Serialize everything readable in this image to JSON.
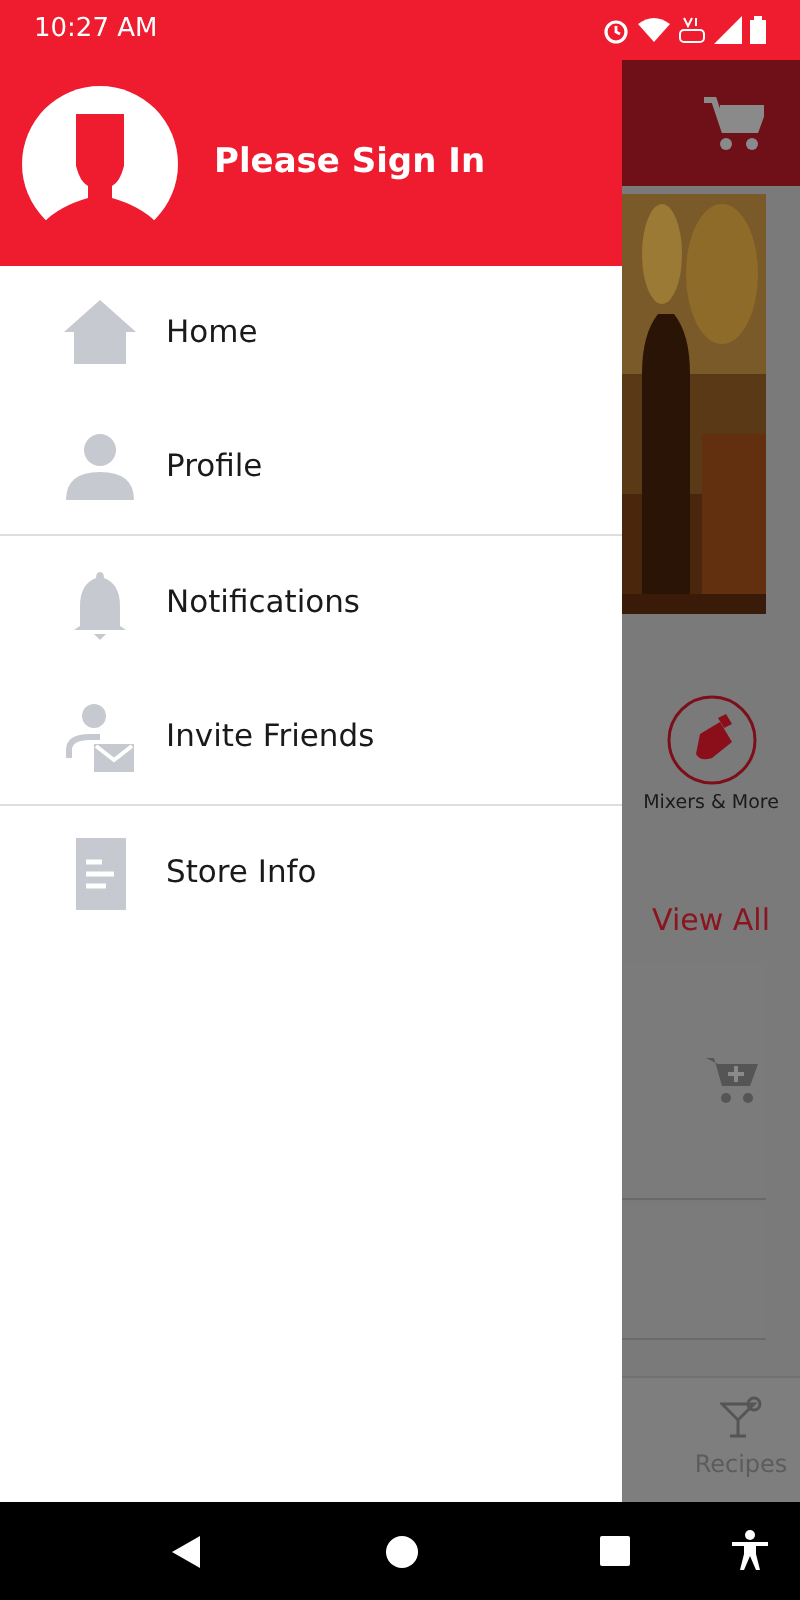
{
  "status_bar": {
    "time": "10:27 AM"
  },
  "drawer": {
    "header": {
      "title": "Please Sign In"
    },
    "sections": [
      {
        "items": [
          {
            "label": "Home"
          },
          {
            "label": "Profile"
          }
        ]
      },
      {
        "items": [
          {
            "label": "Notifications"
          },
          {
            "label": "Invite Friends"
          }
        ]
      },
      {
        "items": [
          {
            "label": "Store Info"
          }
        ]
      }
    ]
  },
  "background": {
    "category": {
      "label": "Mixers & More"
    },
    "link": "View All",
    "bottom_nav": {
      "label": "Recipes"
    }
  }
}
